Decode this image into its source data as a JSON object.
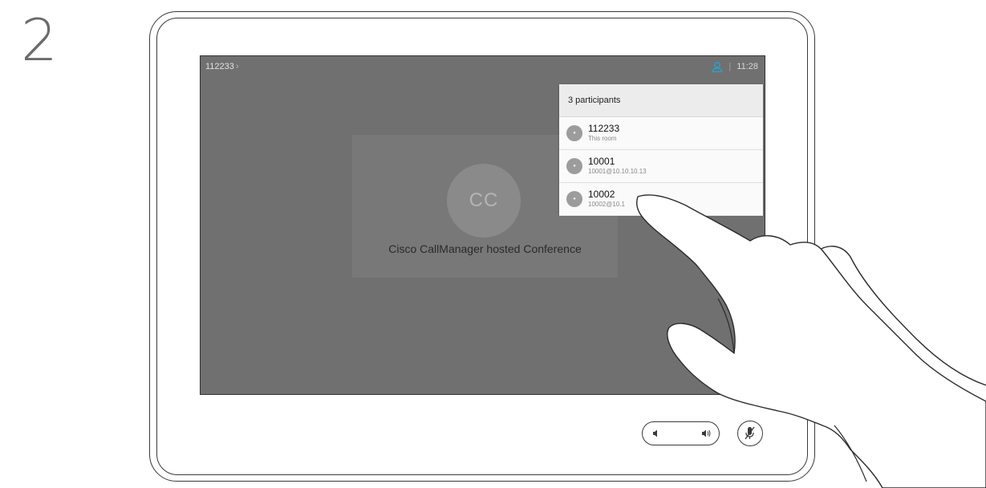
{
  "step": {
    "number": "2"
  },
  "call": {
    "id": "112233",
    "time": "11:28"
  },
  "conference": {
    "avatar_initials": "CC",
    "title": "Cisco CallManager hosted Conference"
  },
  "participants_panel": {
    "header": "3 participants",
    "items": [
      {
        "name": "112233",
        "sub": "This room"
      },
      {
        "name": "10001",
        "sub": "10001@10.10.10.13"
      },
      {
        "name": "10002",
        "sub": "10002@10.1"
      }
    ]
  },
  "icons": {
    "call_chevron": "chevron-right-icon",
    "participants": "person-icon",
    "volume_down": "volume-down-icon",
    "volume_up": "volume-up-icon",
    "mute": "microphone-muted-icon"
  },
  "colors": {
    "screen": "#707070",
    "accent": "#1ea7d6",
    "panel": "#f2f2f2"
  }
}
